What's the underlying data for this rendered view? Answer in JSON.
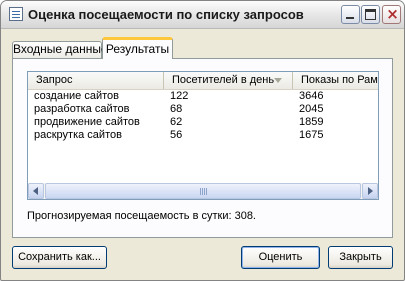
{
  "window": {
    "title": "Оценка посещаемости по списку запросов",
    "controls": {
      "minimize": "minimize",
      "maximize": "maximize",
      "close": "×"
    }
  },
  "tabs": [
    {
      "label": "Входные данные",
      "active": false
    },
    {
      "label": "Результаты",
      "active": true
    }
  ],
  "table": {
    "columns": [
      "Запрос",
      "Посетителей в день",
      "Показы по Рамблеру"
    ],
    "sorted_column": "Посетителей в день",
    "rows": [
      {
        "query": "создание сайтов",
        "visitors": "122",
        "impressions": "3646"
      },
      {
        "query": "разработка сайтов",
        "visitors": "68",
        "impressions": "2045"
      },
      {
        "query": "продвижение сайтов",
        "visitors": "62",
        "impressions": "1859"
      },
      {
        "query": "раскрутка сайтов",
        "visitors": "56",
        "impressions": "1675"
      }
    ]
  },
  "forecast_text": "Прогнозируемая посещаемость в сутки: 308.",
  "buttons": {
    "save": "Сохранить как...",
    "evaluate": "Оценить",
    "close": "Закрыть"
  },
  "colors": {
    "active_tab_accent": "#ffc83c",
    "list_border": "#7f9db9",
    "button_border": "#003c74"
  }
}
